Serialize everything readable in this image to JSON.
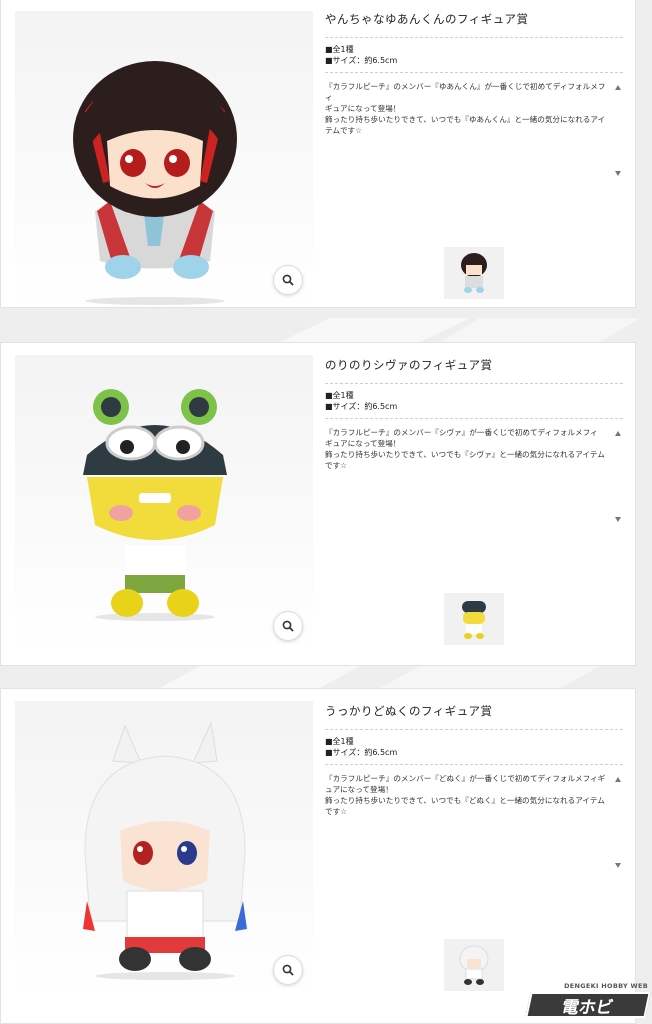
{
  "items": [
    {
      "title": "やんちゃなゆあんくんのフィギュア賞",
      "spec_count": "■全1種",
      "spec_size": "■サイズ：約6.5cm",
      "desc_line1": "『カラフルピーチ』のメンバー『ゆあんくん』が一番くじで初めてディフォルメフィ",
      "desc_line2": "ギュアになって登場！",
      "desc_line3": "飾ったり持ち歩いたりできて、いつでも『ゆあんくん』と一緒の気分になれるアイ",
      "desc_line4": "テムです☆"
    },
    {
      "title": "のりのりシヴァのフィギュア賞",
      "spec_count": "■全1種",
      "spec_size": "■サイズ：約6.5cm",
      "desc_line1": "『カラフルピーチ』のメンバー『シヴァ』が一番くじで初めてディフォルメフィ",
      "desc_line2": "ギュアになって登場！",
      "desc_line3": "飾ったり持ち歩いたりできて、いつでも『シヴァ』と一緒の気分になれるアイテム",
      "desc_line4": "です☆"
    },
    {
      "title": "うっかりどぬくのフィギュア賞",
      "spec_count": "■全1種",
      "spec_size": "■サイズ：約6.5cm",
      "desc_line1": "『カラフルピーチ』のメンバー『どぬく』が一番くじで初めてディフォルメフィギ",
      "desc_line2": "ュアになって登場！",
      "desc_line3": "飾ったり持ち歩いたりできて、いつでも『どぬく』と一緒の気分になれるアイテム",
      "desc_line4": "です☆"
    }
  ],
  "watermark": {
    "top": "DENGEKI HOBBY WEB",
    "logo": "電ホビ"
  },
  "icons": {
    "zoom": "magnifier-icon"
  }
}
